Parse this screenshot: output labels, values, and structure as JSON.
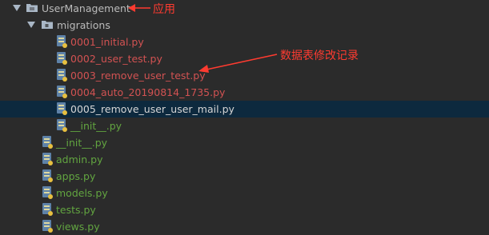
{
  "tree": {
    "root": {
      "label": "UserManagement",
      "icon": "folder-icon"
    },
    "migrations": {
      "label": "migrations",
      "icon": "package-folder-icon"
    },
    "migration_files": [
      {
        "label": "0001_initial.py",
        "color": "#d25252"
      },
      {
        "label": "0002_user_test.py",
        "color": "#d25252"
      },
      {
        "label": "0003_remove_user_test.py",
        "color": "#d25252"
      },
      {
        "label": "0004_auto_20190814_1735.py",
        "color": "#d25252"
      },
      {
        "label": "0005_remove_user_user_mail.py",
        "color": "#d6d6d6",
        "selected": true
      },
      {
        "label": "__init__.py",
        "color": "#62a540"
      }
    ],
    "app_files": [
      {
        "label": "__init__.py"
      },
      {
        "label": "admin.py"
      },
      {
        "label": "apps.py"
      },
      {
        "label": "models.py"
      },
      {
        "label": "tests.py"
      },
      {
        "label": "views.py"
      }
    ]
  },
  "annotations": {
    "app_note": "应用",
    "migration_note": "数据表修改记录",
    "color": "#ff3b30"
  },
  "colors": {
    "background": "#2b2b2b",
    "selection": "#0d293e",
    "unversioned": "#d25252",
    "added": "#62a540"
  }
}
